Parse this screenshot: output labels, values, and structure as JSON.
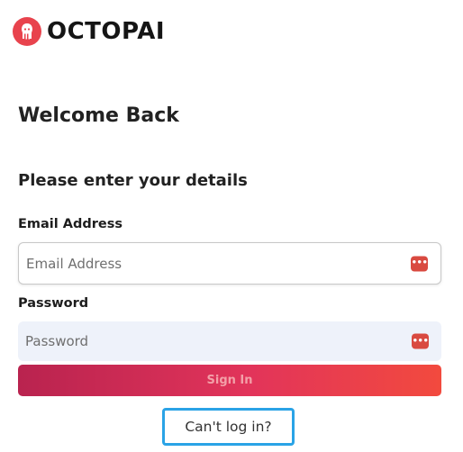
{
  "brand": {
    "name": "OCTOPAI",
    "logo_icon": "octopus-logo-icon",
    "accent_color": "#e8434d"
  },
  "heading": {
    "welcome": "Welcome Back",
    "subtitle": "Please enter your details"
  },
  "form": {
    "email": {
      "label": "Email Address",
      "placeholder": "Email Address",
      "value": ""
    },
    "password": {
      "label": "Password",
      "placeholder": "Password",
      "value": ""
    },
    "password_manager_icon": "password-manager-icon",
    "submit_label": "Sign In",
    "submit_gradient": [
      "#b9234f",
      "#f24a3e"
    ]
  },
  "help": {
    "cant_login_label": "Can't log in?",
    "highlight_color": "#2aa3e6"
  }
}
